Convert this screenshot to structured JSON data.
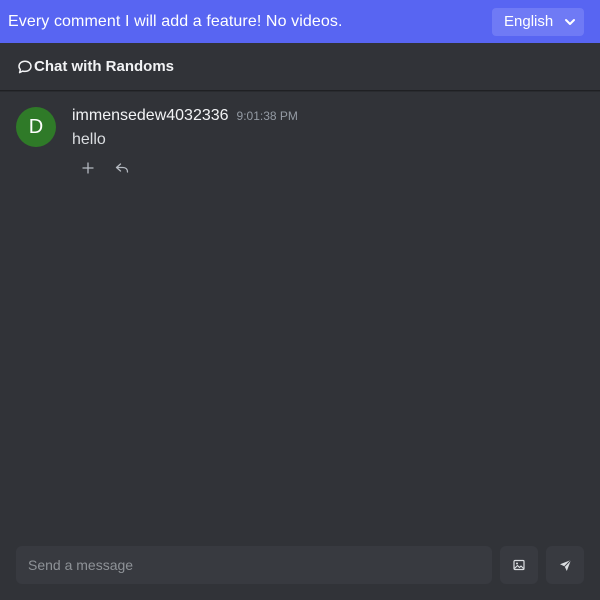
{
  "banner": {
    "text": "Every comment I will add a feature! No videos.",
    "language": "English"
  },
  "header": {
    "icon": "chat-bubble-icon",
    "title": "Chat with Randoms"
  },
  "messages": [
    {
      "avatar_letter": "D",
      "avatar_color": "#2f7a28",
      "author": "immensedew4032336",
      "time": "9:01:38 PM",
      "text": "hello"
    }
  ],
  "composer": {
    "placeholder": "Send a message",
    "image_icon": "image-icon",
    "send_icon": "send-icon"
  },
  "colors": {
    "accent": "#5865f2",
    "background": "#313338"
  }
}
